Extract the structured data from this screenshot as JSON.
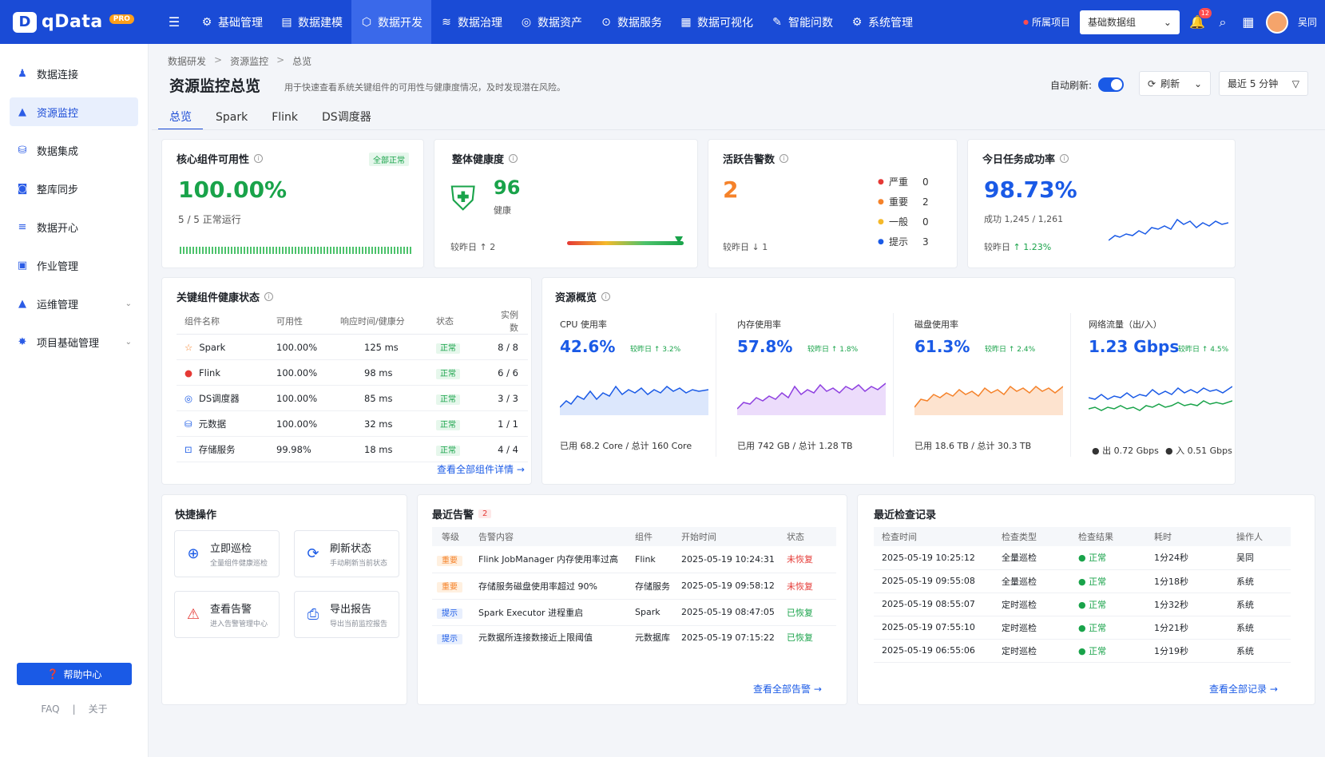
{
  "app": {
    "logo_mark": "D",
    "name": "qData",
    "badge": "PRO",
    "menu_icon": "☰"
  },
  "topnav": [
    {
      "label": "基础管理",
      "icon": "⚙"
    },
    {
      "label": "数据建模",
      "icon": "▤"
    },
    {
      "label": "数据开发",
      "icon": "⬡"
    },
    {
      "label": "数据治理",
      "icon": "≋"
    },
    {
      "label": "数据资产",
      "icon": "◎"
    },
    {
      "label": "数据服务",
      "icon": "⊙"
    },
    {
      "label": "数据可视化",
      "icon": "▦"
    },
    {
      "label": "智能问数",
      "icon": "✎"
    },
    {
      "label": "系统管理",
      "icon": "⚙"
    }
  ],
  "top_right": {
    "project_label": "所属项目",
    "project_dot": "●",
    "project_value": "基础数据组",
    "caret": "⌄",
    "notif_count": "12",
    "bell": "🔔",
    "search": "⌕",
    "grid": "▦",
    "user": "吴同"
  },
  "sidebar": [
    {
      "label": "数据连接",
      "icon": "♟"
    },
    {
      "label": "资源监控",
      "icon": "▲"
    },
    {
      "label": "数据集成",
      "icon": "⛁"
    },
    {
      "label": "整库同步",
      "icon": "◙"
    },
    {
      "label": "数据开心",
      "icon": "≡"
    },
    {
      "label": "作业管理",
      "icon": "▣"
    },
    {
      "label": "运维管理",
      "icon": "▲",
      "caret": "⌄"
    },
    {
      "label": "项目基础管理",
      "icon": "✸",
      "caret": "⌄"
    }
  ],
  "help": {
    "icon": "❓",
    "label": "帮助中心"
  },
  "foot": {
    "faq": "FAQ",
    "sep": "|",
    "about": "关于"
  },
  "breadcrumb": [
    "数据研发",
    "资源监控",
    "总览"
  ],
  "breadcrumb_sep": ">",
  "page": {
    "title": "资源监控总览",
    "desc": "用于快速查看系统关键组件的可用性与健康度情况，及时发现潜在风险。"
  },
  "tabs": [
    "总览",
    "Spark",
    "Flink",
    "DS调度器"
  ],
  "controls": {
    "auto_refresh": "自动刷新:",
    "refresh": "刷新",
    "refresh_icon": "⟳",
    "time_range": "最近 5 分钟",
    "caret": "⌄",
    "select_caret": "▽"
  },
  "info_icon": "i",
  "kpi": {
    "availability": {
      "title": "核心组件可用性",
      "tag": "全部正常",
      "value": "100.00%",
      "sub": "5 / 5 正常运行"
    },
    "health": {
      "title": "整体健康度",
      "score": "96",
      "status": "健康",
      "compare": "较昨日 ↑ 2",
      "shield": "⛨",
      "level": 0.96
    },
    "alerts": {
      "title": "活跃告警数",
      "value": "2",
      "compare": "较昨日 ↓ 1",
      "levels": [
        {
          "name": "严重",
          "count": "0",
          "color": "#e53935"
        },
        {
          "name": "重要",
          "count": "2",
          "color": "#f5822a"
        },
        {
          "name": "一般",
          "count": "0",
          "color": "#f5b92a"
        },
        {
          "name": "提示",
          "count": "3",
          "color": "#1a5ae6"
        }
      ],
      "bullet": "●"
    },
    "success": {
      "title": "今日任务成功率",
      "value": "98.73%",
      "sub": "成功 1,245 / 1,261",
      "compare_label": "较昨日",
      "compare_value": "↑ 1.23%"
    }
  },
  "health_table": {
    "title": "关键组件健康状态",
    "columns": [
      "组件名称",
      "可用性",
      "响应时间/健康分",
      "状态",
      "实例数"
    ],
    "rows": [
      {
        "name": "Spark",
        "avail": "100.00%",
        "resp": "125 ms",
        "status": "正常",
        "inst": "8 / 8",
        "icon": "☆",
        "icon_color": "#f5822a"
      },
      {
        "name": "Flink",
        "avail": "100.00%",
        "resp": "98 ms",
        "status": "正常",
        "inst": "6 / 6",
        "icon": "●",
        "icon_color": "#e53935"
      },
      {
        "name": "DS调度器",
        "avail": "100.00%",
        "resp": "85 ms",
        "status": "正常",
        "inst": "3 / 3",
        "icon": "◎",
        "icon_color": "#1a5ae6"
      },
      {
        "name": "元数据",
        "avail": "100.00%",
        "resp": "32 ms",
        "status": "正常",
        "inst": "1 / 1",
        "icon": "⛁",
        "icon_color": "#1a5ae6"
      },
      {
        "name": "存储服务",
        "avail": "99.98%",
        "resp": "18 ms",
        "status": "正常",
        "inst": "4 / 4",
        "icon": "⊡",
        "icon_color": "#1a5ae6"
      }
    ],
    "link": "查看全部组件详情 →"
  },
  "resources": {
    "title": "资源概览",
    "items": [
      {
        "label": "CPU 使用率",
        "value": "42.6%",
        "compare": "较昨日 ↑ 3.2%",
        "footer": "已用 68.2 Core / 总计  160 Core",
        "color": "#1a5ae6"
      },
      {
        "label": "内存使用率",
        "value": "57.8%",
        "compare": "较昨日 ↑ 1.8%",
        "footer": "已用 742 GB / 总计  1.28 TB",
        "color": "#8e3fe0"
      },
      {
        "label": "磁盘使用率",
        "value": "61.3%",
        "compare": "较昨日 ↑ 2.4%",
        "footer": "已用 18.6 TB / 总计  30.3 TB",
        "color": "#f5822a"
      },
      {
        "label": "网络流量（出/入）",
        "value": "1.23 Gbps",
        "compare": "较昨日 ↑ 4.5%",
        "footer_out": "● 出 0.72 Gbps",
        "footer_in": "● 入 0.51 Gbps",
        "color": "#1a5ae6"
      }
    ]
  },
  "quick": {
    "title": "快捷操作",
    "items": [
      {
        "title": "立即巡检",
        "sub": "全量组件健康巡检",
        "icon": "⊕"
      },
      {
        "title": "刷新状态",
        "sub": "手动刷新当前状态",
        "icon": "⟳"
      },
      {
        "title": "查看告警",
        "sub": "进入告警管理中心",
        "icon": "⚠"
      },
      {
        "title": "导出报告",
        "sub": "导出当前监控报告",
        "icon": "⎙"
      }
    ]
  },
  "recent_alerts": {
    "title": "最近告警",
    "count": "2",
    "columns": [
      "等级",
      "告警内容",
      "组件",
      "开始时间",
      "状态"
    ],
    "rows": [
      {
        "level": "重要",
        "content": "Flink JobManager 内存使用率过高",
        "comp": "Flink",
        "time": "2025-05-19 10:24:31",
        "status": "未恢复",
        "kind": "hi",
        "state": "red"
      },
      {
        "level": "重要",
        "content": "存储服务磁盘使用率超过 90%",
        "comp": "存储服务",
        "time": "2025-05-19 09:58:12",
        "status": "未恢复",
        "kind": "hi",
        "state": "red"
      },
      {
        "level": "提示",
        "content": "Spark Executor 进程重启",
        "comp": "Spark",
        "time": "2025-05-19 08:47:05",
        "status": "已恢复",
        "kind": "info",
        "state": "green"
      },
      {
        "level": "提示",
        "content": "元数据所连接数接近上限阈值",
        "comp": "元数据库",
        "time": "2025-05-19 07:15:22",
        "status": "已恢复",
        "kind": "info",
        "state": "green"
      }
    ],
    "link": "查看全部告警 →"
  },
  "inspections": {
    "title": "最近检查记录",
    "columns": [
      "检查时间",
      "检查类型",
      "检查结果",
      "耗时",
      "操作人"
    ],
    "rows": [
      {
        "time": "2025-05-19 10:25:12",
        "type": "全量巡检",
        "result": "● 正常",
        "dur": "1分24秒",
        "op": "吴同"
      },
      {
        "time": "2025-05-19 09:55:08",
        "type": "全量巡检",
        "result": "● 正常",
        "dur": "1分18秒",
        "op": "系统"
      },
      {
        "time": "2025-05-19 08:55:07",
        "type": "定时巡检",
        "result": "● 正常",
        "dur": "1分32秒",
        "op": "系统"
      },
      {
        "time": "2025-05-19 07:55:10",
        "type": "定时巡检",
        "result": "● 正常",
        "dur": "1分21秒",
        "op": "系统"
      },
      {
        "time": "2025-05-19 06:55:06",
        "type": "定时巡检",
        "result": "● 正常",
        "dur": "1分19秒",
        "op": "系统"
      }
    ],
    "link": "查看全部记录 →"
  }
}
